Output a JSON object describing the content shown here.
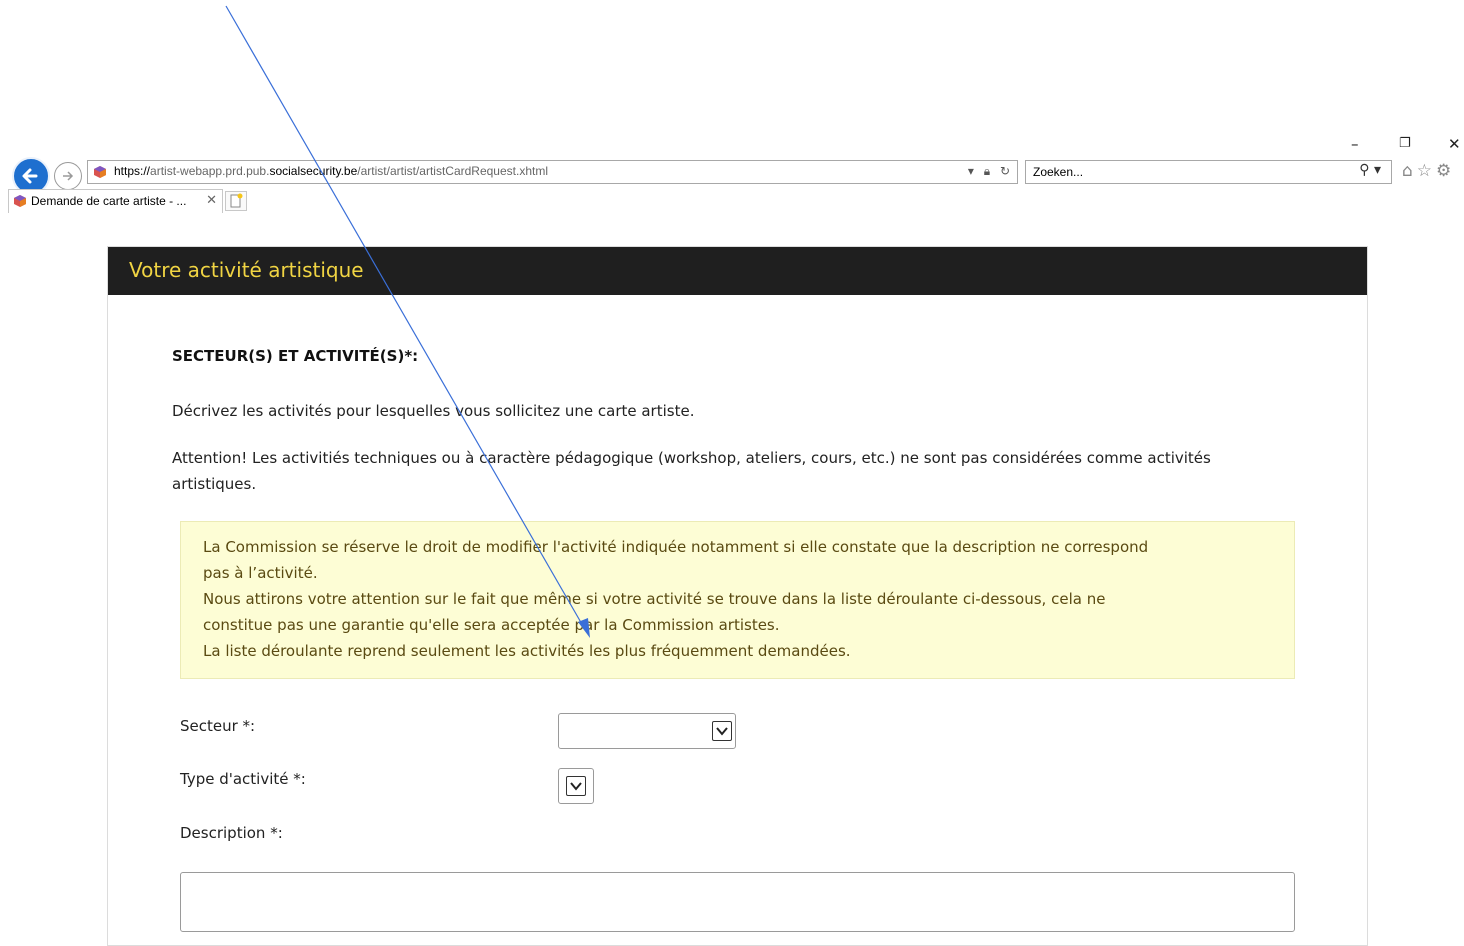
{
  "window": {
    "minimize_glyph": "–",
    "restore_glyph": "❐",
    "close_glyph": "✕"
  },
  "browser": {
    "url_scheme": "https://",
    "url_host_prefix": "artist-webapp.prd.pub.",
    "url_host_domain": "socialsecurity.be",
    "url_path": "/artist/artist/artistCardRequest.xhtml",
    "search_placeholder": "Zoeken...",
    "tab_title": "Demande de carte artiste - ...",
    "icons": [
      "back-icon",
      "forward-icon",
      "dropdown-icon",
      "lock-icon",
      "refresh-icon",
      "search-icon",
      "home-icon",
      "favorites-icon",
      "settings-icon",
      "close-tab-icon",
      "new-tab-icon"
    ]
  },
  "card": {
    "title": "Votre activité artistique",
    "section_heading": "SECTEUR(S) ET ACTIVITÉ(S)*:",
    "intro": "Décrivez les activités pour lesquelles vous sollicitez une carte artiste.",
    "warning": "Attention! Les activitiés techniques ou à caractère pédagogique (workshop, ateliers, cours, etc.) ne sont pas considérées comme activités artistiques.",
    "notice_lines": [
      "La Commission se réserve le droit de modifier l'activité indiquée notamment si elle constate que la description ne correspond",
      "pas à l’activité.",
      "Nous attirons votre attention sur le fait que même si votre activité se trouve dans la liste déroulante ci-dessous, cela ne",
      "constitue pas une garantie qu'elle sera acceptée par la Commission artistes.",
      "La liste déroulante reprend seulement les activités les plus fréquemment demandées."
    ],
    "fields": {
      "secteur_label": "Secteur *:",
      "secteur_value": "",
      "type_label": "Type d'activité *:",
      "type_value": "",
      "description_label": "Description *:",
      "description_value": ""
    }
  },
  "colors": {
    "header_bg": "#1f1f1f",
    "header_text": "#f0d443",
    "notice_bg": "#fdfdd5",
    "notice_text": "#5a4a12",
    "annotation_arrow": "#3a6fd8"
  }
}
